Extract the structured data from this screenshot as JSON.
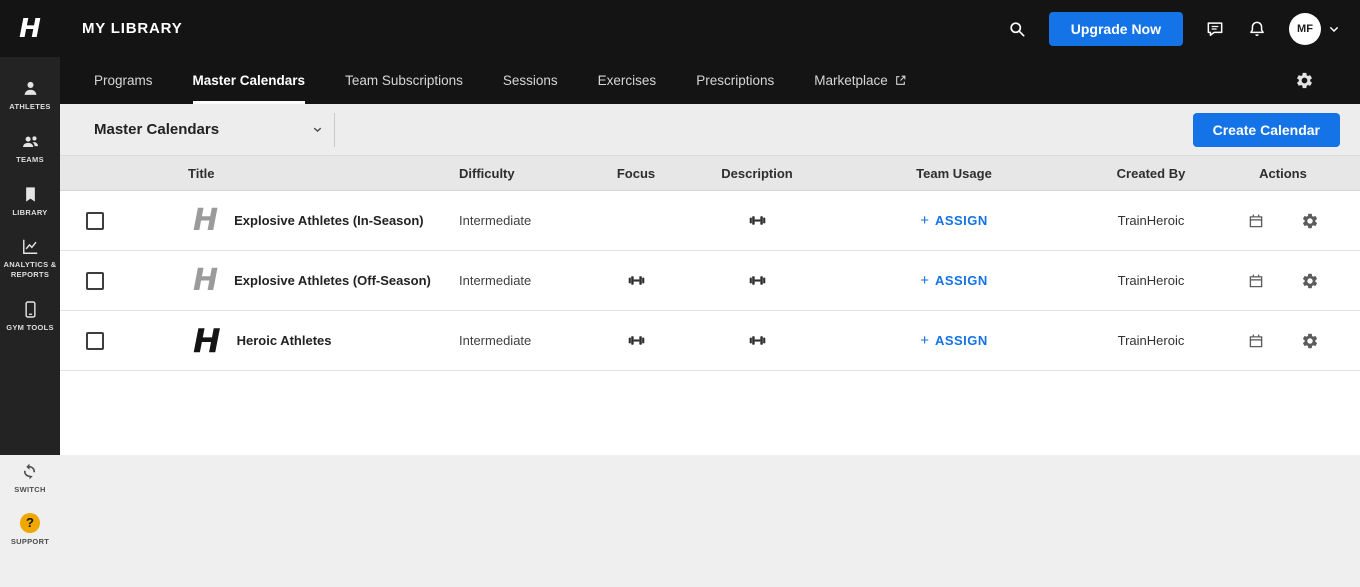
{
  "brand": {
    "letter": "H"
  },
  "colors": {
    "accent_blue": "#1473e6",
    "support_yellow": "#f0a800",
    "topbar_bg": "#141414",
    "sidebar_bg": "#232323"
  },
  "sidebar": {
    "items": [
      {
        "label": "ATHLETES",
        "icon": "athlete-icon"
      },
      {
        "label": "TEAMS",
        "icon": "teams-icon"
      },
      {
        "label": "LIBRARY",
        "icon": "library-icon"
      },
      {
        "label": "ANALYTICS & REPORTS",
        "icon": "analytics-icon"
      },
      {
        "label": "GYM TOOLS",
        "icon": "gym-tools-icon"
      }
    ],
    "bottom": [
      {
        "label": "SWITCH",
        "icon": "switch-icon"
      },
      {
        "label": "SUPPORT",
        "icon": "support-icon",
        "glyph": "?"
      }
    ]
  },
  "topbar": {
    "title": "MY LIBRARY",
    "upgrade_button": "Upgrade Now",
    "avatar_initials": "MF"
  },
  "nav": {
    "tabs": [
      {
        "label": "Programs",
        "active": false
      },
      {
        "label": "Master Calendars",
        "active": true
      },
      {
        "label": "Team Subscriptions",
        "active": false
      },
      {
        "label": "Sessions",
        "active": false
      },
      {
        "label": "Exercises",
        "active": false
      },
      {
        "label": "Prescriptions",
        "active": false
      },
      {
        "label": "Marketplace",
        "active": false,
        "external": true
      }
    ]
  },
  "toolbar": {
    "filter_value": "Master Calendars",
    "create_button": "Create Calendar"
  },
  "table": {
    "headers": [
      "Title",
      "Difficulty",
      "Focus",
      "Description",
      "Team Usage",
      "Created By",
      "Actions"
    ],
    "assign_plus": "+",
    "assign_label": "ASSIGN",
    "rows": [
      {
        "title": "Explosive Athletes (In-Season)",
        "difficulty": "Intermediate",
        "has_focus": false,
        "has_description": true,
        "created_by": "TrainHeroic"
      },
      {
        "title": "Explosive Athletes (Off-Season)",
        "difficulty": "Intermediate",
        "has_focus": true,
        "has_description": true,
        "created_by": "TrainHeroic"
      },
      {
        "title": "Heroic Athletes",
        "difficulty": "Intermediate",
        "has_focus": true,
        "has_description": true,
        "created_by": "TrainHeroic"
      }
    ]
  }
}
